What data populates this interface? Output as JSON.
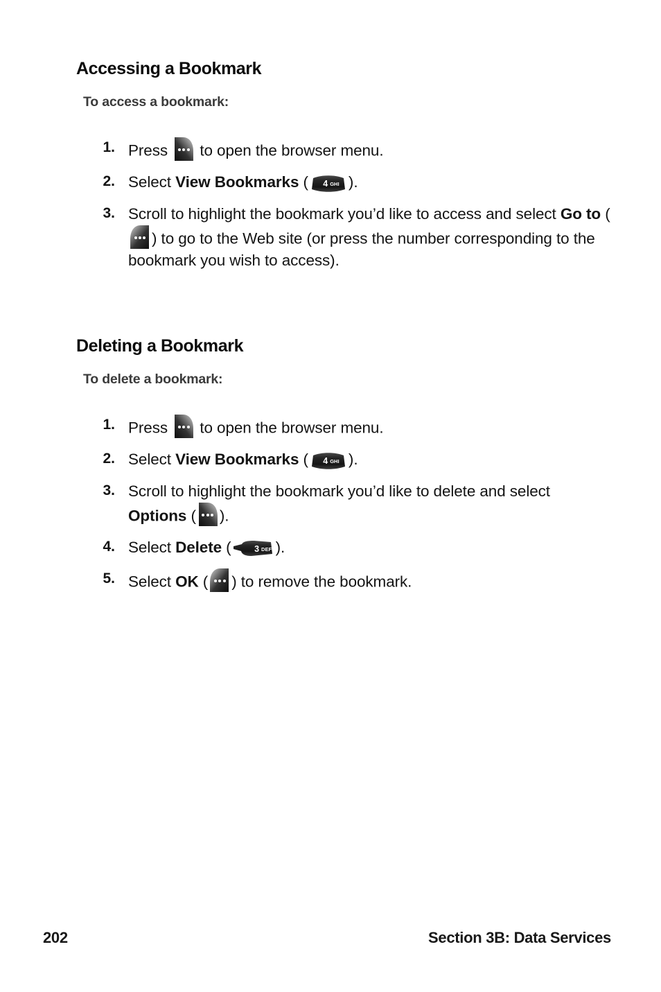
{
  "page": {
    "background_color": "#ffffff",
    "text_color": "#141414",
    "heading_color": "#0b0b0b",
    "subtitle_color": "#3b3b3b"
  },
  "sections": [
    {
      "heading": "Accessing a Bookmark",
      "subtitle": "To access a bookmark:",
      "steps": [
        {
          "number": "1.",
          "parts": [
            {
              "type": "text",
              "value": "Press "
            },
            {
              "type": "icon",
              "icon": "softkey-right-menu-icon",
              "label": "menu soft key"
            },
            {
              "type": "text",
              "value": " to open the browser menu."
            }
          ]
        },
        {
          "number": "2.",
          "parts": [
            {
              "type": "text",
              "value": "Select "
            },
            {
              "type": "bold",
              "value": "View Bookmarks"
            },
            {
              "type": "text",
              "value": " ("
            },
            {
              "type": "icon",
              "icon": "key-4-ghi-icon",
              "digit": "4",
              "letters": "GHI"
            },
            {
              "type": "text",
              "value": ")."
            }
          ]
        },
        {
          "number": "3.",
          "parts": [
            {
              "type": "text",
              "value": "Scroll to highlight the bookmark you’d like to access and select "
            },
            {
              "type": "bold",
              "value": "Go to"
            },
            {
              "type": "text",
              "value": " ("
            },
            {
              "type": "icon",
              "icon": "softkey-left-menu-icon",
              "label": "go to soft key"
            },
            {
              "type": "text",
              "value": ") to go to the Web site (or press the number corresponding to the bookmark you wish to access)."
            }
          ]
        }
      ]
    },
    {
      "heading": "Deleting a Bookmark",
      "subtitle": "To delete a bookmark:",
      "steps": [
        {
          "number": "1.",
          "parts": [
            {
              "type": "text",
              "value": "Press "
            },
            {
              "type": "icon",
              "icon": "softkey-right-menu-icon",
              "label": "menu soft key"
            },
            {
              "type": "text",
              "value": " to open the browser menu."
            }
          ]
        },
        {
          "number": "2.",
          "parts": [
            {
              "type": "text",
              "value": "Select "
            },
            {
              "type": "bold",
              "value": "View Bookmarks"
            },
            {
              "type": "text",
              "value": " ("
            },
            {
              "type": "icon",
              "icon": "key-4-ghi-icon",
              "digit": "4",
              "letters": "GHI"
            },
            {
              "type": "text",
              "value": ")."
            }
          ]
        },
        {
          "number": "3.",
          "parts": [
            {
              "type": "text",
              "value": "Scroll to highlight the bookmark you’d like to delete and select "
            },
            {
              "type": "bold",
              "value": "Options"
            },
            {
              "type": "text",
              "value": " ("
            },
            {
              "type": "icon",
              "icon": "softkey-right-menu-icon",
              "label": "options soft key"
            },
            {
              "type": "text",
              "value": ")."
            }
          ]
        },
        {
          "number": "4.",
          "parts": [
            {
              "type": "text",
              "value": "Select "
            },
            {
              "type": "bold",
              "value": "Delete"
            },
            {
              "type": "text",
              "value": " ("
            },
            {
              "type": "icon",
              "icon": "key-3-def-icon",
              "digit": "3",
              "letters": "DEF"
            },
            {
              "type": "text",
              "value": ")."
            }
          ]
        },
        {
          "number": "5.",
          "parts": [
            {
              "type": "text",
              "value": "Select "
            },
            {
              "type": "bold",
              "value": "OK"
            },
            {
              "type": "text",
              "value": " ("
            },
            {
              "type": "icon",
              "icon": "softkey-left-menu-icon",
              "label": "ok soft key"
            },
            {
              "type": "text",
              "value": ") to remove the bookmark."
            }
          ]
        }
      ]
    }
  ],
  "footer": {
    "page_number": "202",
    "section_label": "Section 3B: Data Services"
  }
}
